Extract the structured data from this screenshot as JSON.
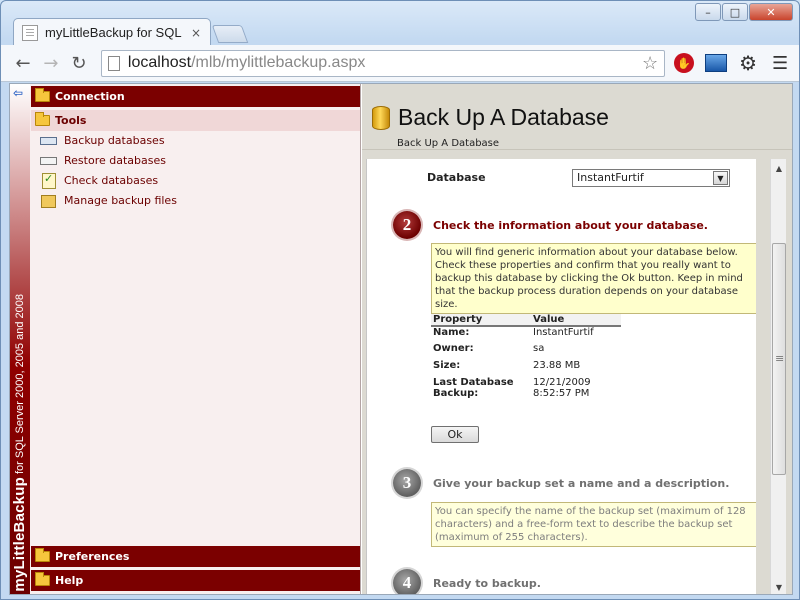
{
  "browser": {
    "tab_title": "myLittleBackup for SQL Se",
    "tab_close": "×",
    "url_host": "localhost",
    "url_path": "/mlb/mylittlebackup.aspx",
    "window_buttons": {
      "minimize": "–",
      "maximize": "□",
      "close": "✕"
    }
  },
  "sidebar": {
    "back_arrow": "⇦",
    "brand_main": "myLittleBackup",
    "brand_sub": " for SQL Server 2000, 2005 and 2008",
    "sections": {
      "connection": "Connection",
      "tools": "Tools",
      "preferences": "Preferences",
      "help": "Help"
    },
    "tools_items": [
      {
        "label": "Backup databases",
        "icon": "backup-disk-icon"
      },
      {
        "label": "Restore databases",
        "icon": "restore-disk-icon"
      },
      {
        "label": "Check databases",
        "icon": "check-document-icon"
      },
      {
        "label": "Manage backup files",
        "icon": "manage-files-icon"
      }
    ]
  },
  "header": {
    "title": "Back Up A Database",
    "breadcrumb": "Back Up A Database"
  },
  "form": {
    "database_label": "Database",
    "database_value": "InstantFurtif",
    "steps": [
      {
        "number": "2",
        "title": "Check the information about your database.",
        "note": "You will find generic information about your database below. Check these properties and confirm that you really want to backup this database by clicking the Ok button. Keep in mind that the backup process duration depends on your database size."
      },
      {
        "number": "3",
        "title": "Give your backup set a name and a description.",
        "note": "You can specify the name of the backup set (maximum of 128 characters) and a free-form text to describe the backup set (maximum of 255 characters)."
      },
      {
        "number": "4",
        "title": "Ready to backup."
      }
    ],
    "table": {
      "headers": [
        "Property",
        "Value"
      ],
      "rows": [
        [
          "Name:",
          "InstantFurtif"
        ],
        [
          "Owner:",
          "sa"
        ],
        [
          "Size:",
          "23.88 MB"
        ],
        [
          "Last Database Backup:",
          "12/21/2009 8:52:57 PM"
        ]
      ]
    },
    "ok_label": "Ok"
  }
}
